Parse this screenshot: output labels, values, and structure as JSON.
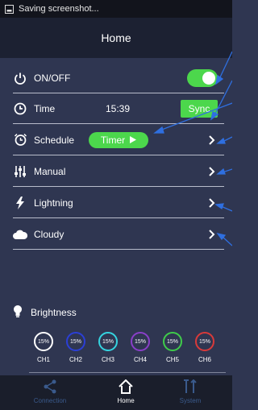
{
  "status_bar": {
    "text": "Saving screenshot...",
    "icon": "screenshot-icon"
  },
  "header": {
    "title": "Home"
  },
  "rows": {
    "onoff": {
      "label": "ON/OFF",
      "icon": "power-icon",
      "toggle_on": true
    },
    "time": {
      "label": "Time",
      "icon": "clock-icon",
      "value": "15:39",
      "button": "Sync"
    },
    "schedule": {
      "label": "Schedule",
      "icon": "alarm-clock-icon",
      "button": "Timer"
    },
    "manual": {
      "label": "Manual",
      "icon": "sliders-icon"
    },
    "lightning": {
      "label": "Lightning",
      "icon": "lightning-icon"
    },
    "cloudy": {
      "label": "Cloudy",
      "icon": "cloud-icon"
    }
  },
  "brightness": {
    "label": "Brightness",
    "icon": "bulb-icon",
    "channels": [
      {
        "name": "CH1",
        "value": "15%",
        "color": "#ffffff"
      },
      {
        "name": "CH2",
        "value": "15%",
        "color": "#2b3fd6"
      },
      {
        "name": "CH3",
        "value": "15%",
        "color": "#35d4e0"
      },
      {
        "name": "CH4",
        "value": "15%",
        "color": "#8a3fc9"
      },
      {
        "name": "CH5",
        "value": "15%",
        "color": "#3fcc4a"
      },
      {
        "name": "CH6",
        "value": "15%",
        "color": "#d93a3a"
      }
    ]
  },
  "bottom_nav": {
    "items": [
      {
        "label": "Connection",
        "icon": "share-icon",
        "active": false
      },
      {
        "label": "Home",
        "icon": "home-icon",
        "active": true
      },
      {
        "label": "System",
        "icon": "tools-icon",
        "active": false
      }
    ]
  },
  "colors": {
    "accent_green": "#4cd74c",
    "background": "#2f3651",
    "header": "#1c2132",
    "annotation_blue": "#2f6fe0"
  }
}
